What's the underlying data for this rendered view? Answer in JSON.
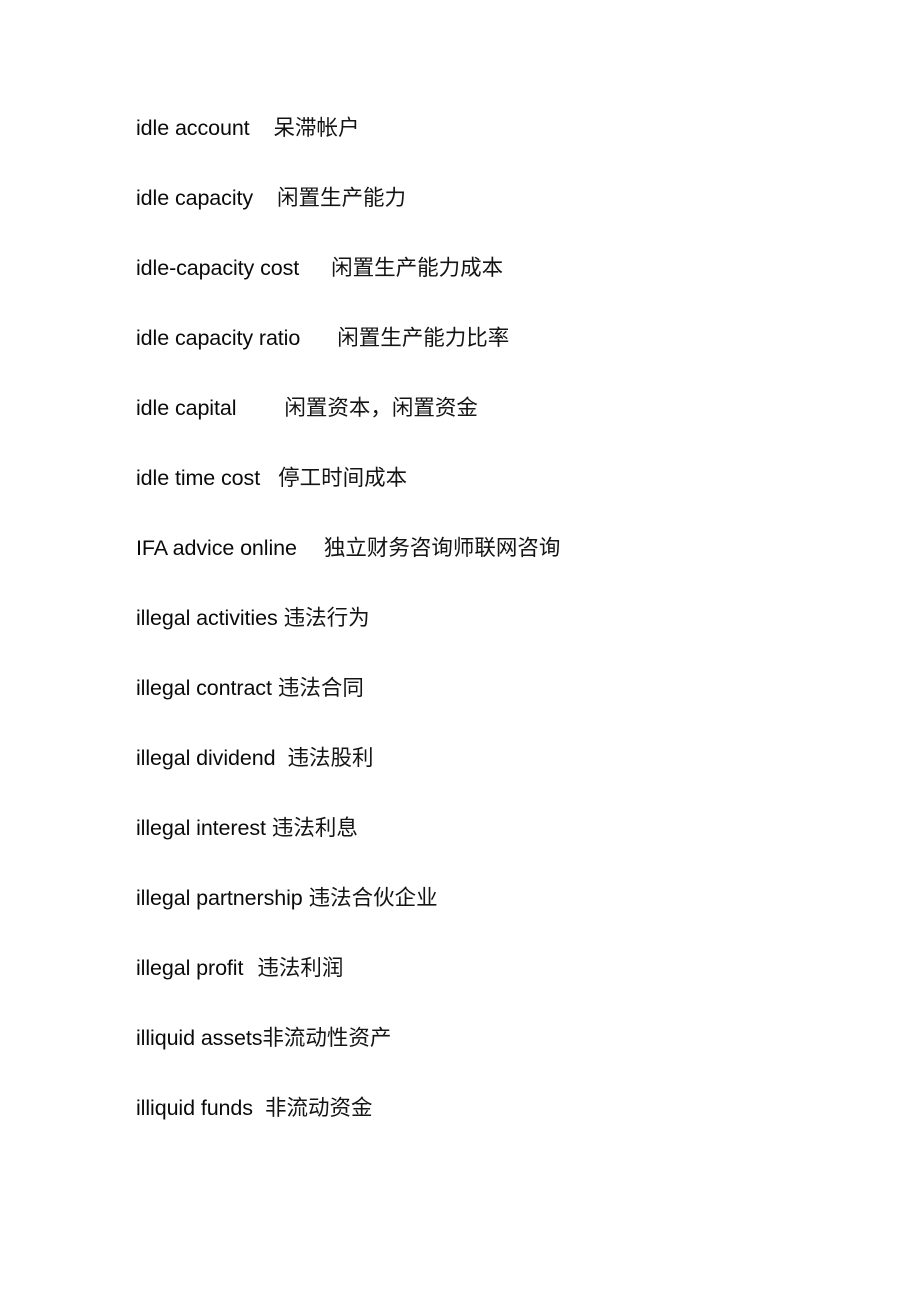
{
  "document": {
    "type": "bilingual-glossary",
    "page_background": "#ffffff",
    "text_color": "#000000",
    "entries": [
      {
        "en": "idle account",
        "zh": "呆滞帐户",
        "gap": 24
      },
      {
        "en": "idle capacity",
        "zh": "闲置生产能力",
        "gap": 24
      },
      {
        "en": "idle-capacity cost",
        "zh": "闲置生产能力成本",
        "gap": 32
      },
      {
        "en": "idle capacity ratio",
        "zh": "闲置生产能力比率",
        "gap": 37
      },
      {
        "en": "idle capital",
        "zh": "闲置资本，闲置资金",
        "gap": 48
      },
      {
        "en": "idle time cost",
        "zh": "停工时间成本",
        "gap": 18
      },
      {
        "en": "IFA advice online",
        "zh": "独立财务咨询师联网咨询",
        "gap": 27
      },
      {
        "en": "illegal activities",
        "zh": "违法行为",
        "gap": 6
      },
      {
        "en": "illegal contract",
        "zh": "违法合同",
        "gap": 6
      },
      {
        "en": "illegal dividend",
        "zh": "违法股利",
        "gap": 12
      },
      {
        "en": "illegal interest",
        "zh": "违法利息",
        "gap": 6
      },
      {
        "en": "illegal partnership",
        "zh": "违法合伙企业",
        "gap": 6
      },
      {
        "en": "illegal profit",
        "zh": "违法利润",
        "gap": 14
      },
      {
        "en": "illiquid assets",
        "zh": "非流动性资产",
        "gap": 0
      },
      {
        "en": "illiquid funds",
        "zh": "非流动资金",
        "gap": 12
      }
    ]
  }
}
